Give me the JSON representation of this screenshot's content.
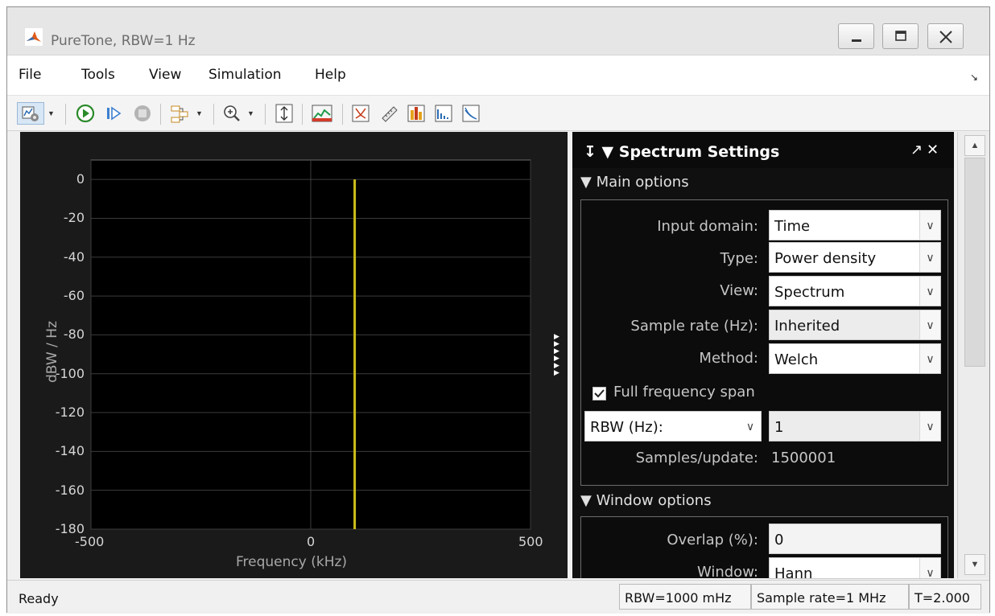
{
  "window": {
    "title": "PureTone, RBW=1 Hz"
  },
  "menu": {
    "items": [
      "File",
      "Tools",
      "View",
      "Simulation",
      "Help"
    ]
  },
  "toolbar": {
    "icons": [
      "settings-icon",
      "run-icon",
      "step-forward-icon",
      "stop-icon",
      "signal-select-icon",
      "zoom-in-icon",
      "scale-axes-icon",
      "spectrum-settings-icon",
      "peak-finder-icon",
      "cursor-measurements-icon",
      "channel-measurements-icon",
      "distortion-measurements-icon",
      "ccdf-measurements-icon"
    ]
  },
  "chart_data": {
    "type": "line",
    "xlabel": "Frequency (kHz)",
    "ylabel": "dBW / Hz",
    "xlim": [
      -500,
      500
    ],
    "ylim": [
      -180,
      10
    ],
    "xticks": [
      "-500",
      "0",
      "500"
    ],
    "yticks": [
      "0",
      "-20",
      "-40",
      "-60",
      "-80",
      "-100",
      "-120",
      "-140",
      "-160",
      "-180"
    ],
    "grid": true,
    "series": [
      {
        "color": "#cdbf1a",
        "x": [
          100,
          100
        ],
        "y": [
          0,
          -180
        ]
      }
    ]
  },
  "panel": {
    "title": "Spectrum Settings",
    "main_section": "Main options",
    "fields": {
      "input_domain_label": "Input domain:",
      "input_domain_value": "Time",
      "type_label": "Type:",
      "type_value": "Power density",
      "view_label": "View:",
      "view_value": "Spectrum",
      "sample_rate_label": "Sample rate (Hz):",
      "sample_rate_value": "Inherited",
      "method_label": "Method:",
      "method_value": "Welch",
      "full_span_label": "Full frequency span",
      "rbw_select": "RBW (Hz):",
      "rbw_value": "1",
      "samples_label": "Samples/update:",
      "samples_value": "1500001"
    },
    "window_section": "Window options",
    "window_fields": {
      "overlap_label": "Overlap (%):",
      "overlap_value": "0",
      "window_label": "Window:",
      "window_value": "Hann"
    }
  },
  "status": {
    "text": "Ready",
    "rbw": "RBW=1000 mHz",
    "sample_rate": "Sample rate=1 MHz",
    "time": "T=2.000"
  }
}
